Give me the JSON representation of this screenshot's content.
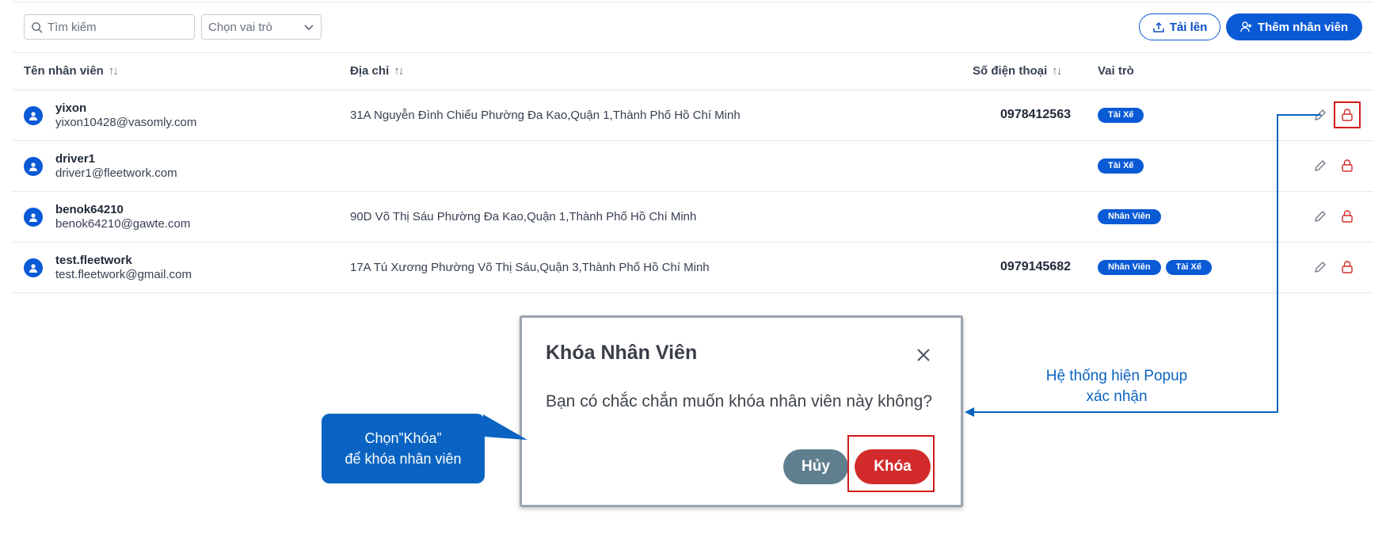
{
  "toolbar": {
    "search_placeholder": "Tìm kiếm",
    "role_select_value": "Chọn vai trò",
    "upload_label": "Tải lên",
    "add_employee_label": "Thêm nhân viên"
  },
  "table": {
    "columns": [
      "Tên nhân viên",
      "Địa chỉ",
      "Số điện thoại",
      "Vai trò"
    ],
    "rows": [
      {
        "name": "yixon",
        "email": "yixon10428@vasomly.com",
        "address": "31A Nguyễn Đình Chiểu Phường Đa Kao,Quận 1,Thành Phố Hồ Chí Minh",
        "phone": "0978412563",
        "roles": [
          "Tài Xế"
        ]
      },
      {
        "name": "driver1",
        "email": "driver1@fleetwork.com",
        "address": "",
        "phone": "",
        "roles": [
          "Tài Xế"
        ]
      },
      {
        "name": "benok64210",
        "email": "benok64210@gawte.com",
        "address": "90D Võ Thị Sáu Phường Đa Kao,Quận 1,Thành Phố Hồ Chí Minh",
        "phone": "",
        "roles": [
          "Nhân Viên"
        ]
      },
      {
        "name": "test.fleetwork",
        "email": "test.fleetwork@gmail.com",
        "address": "17A Tú Xương Phường Võ Thị Sáu,Quận 3,Thành Phố Hồ Chí Minh",
        "phone": "0979145682",
        "roles": [
          "Nhân Viên",
          "Tài Xế"
        ]
      }
    ]
  },
  "modal": {
    "title": "Khóa Nhân Viên",
    "message": "Bạn có chắc chắn muốn khóa nhân viên này không?",
    "cancel_label": "Hủy",
    "confirm_label": "Khóa"
  },
  "annotations": {
    "callout_line1": "Chọn”Khóa”",
    "callout_line2": "để khóa nhân viên",
    "note_line1": "Hệ thống hiện Popup",
    "note_line2": "xác nhận"
  },
  "colors": {
    "primary": "#0a5ad6",
    "danger": "#d32b2b",
    "cancel": "#5f7e8e",
    "highlight": "#d11a1a",
    "annotation": "#0a63c2"
  },
  "icons": [
    "search-icon",
    "chevron-down-icon",
    "upload-icon",
    "add-user-icon",
    "user-avatar-icon",
    "edit-icon",
    "lock-icon",
    "close-icon"
  ]
}
